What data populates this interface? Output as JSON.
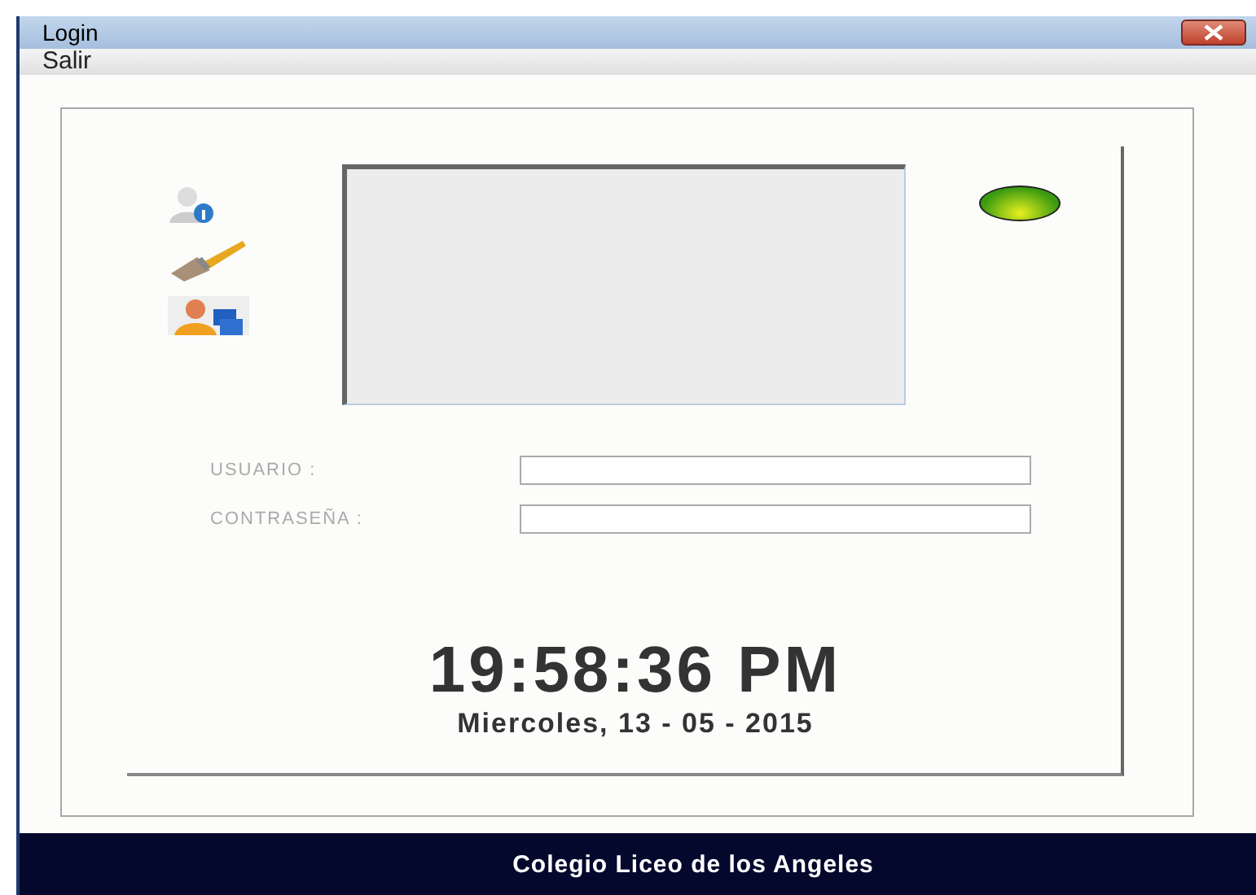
{
  "window": {
    "title": "Login"
  },
  "menu": [
    "Salir"
  ],
  "status_light": {
    "on": true
  },
  "form": {
    "fields": [
      {
        "label": "USUARIO :"
      },
      {
        "label": "CONTRASEÑA :"
      }
    ]
  },
  "clock": {
    "time": "19:58:36 PM",
    "date": "Miercoles, 13 - 05 - 2015"
  },
  "footer": "Colegio Liceo de los Angeles"
}
